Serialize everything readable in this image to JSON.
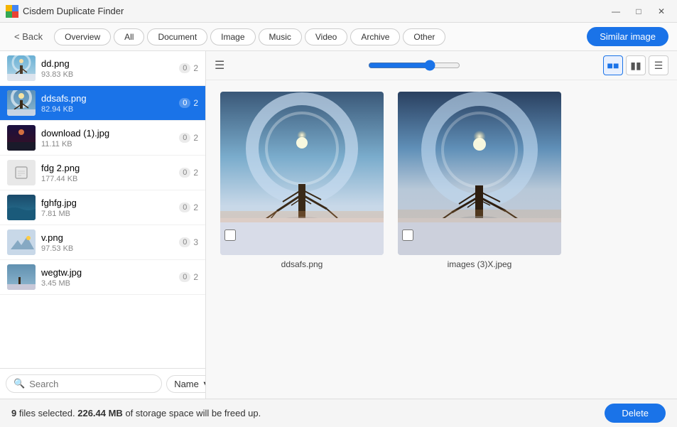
{
  "titleBar": {
    "title": "Cisdem Duplicate Finder",
    "controls": [
      "minimize",
      "maximize",
      "close"
    ]
  },
  "navBar": {
    "backLabel": "< Back",
    "tabs": [
      {
        "label": "Overview",
        "active": false
      },
      {
        "label": "All",
        "active": false
      },
      {
        "label": "Document",
        "active": false
      },
      {
        "label": "Image",
        "active": false
      },
      {
        "label": "Music",
        "active": false
      },
      {
        "label": "Video",
        "active": false
      },
      {
        "label": "Archive",
        "active": false
      },
      {
        "label": "Other",
        "active": false
      }
    ],
    "similarImageBtn": "Similar image"
  },
  "sidebar": {
    "files": [
      {
        "name": "dd.png",
        "size": "93.83 KB",
        "count0": "0",
        "count1": "2",
        "selected": false,
        "hasThumb": true
      },
      {
        "name": "ddsafs.png",
        "size": "82.94 KB",
        "count0": "0",
        "count1": "2",
        "selected": true,
        "hasThumb": true
      },
      {
        "name": "download (1).jpg",
        "size": "11.11 KB",
        "count0": "0",
        "count1": "2",
        "selected": false,
        "hasThumb": true
      },
      {
        "name": "fdg 2.png",
        "size": "177.44 KB",
        "count0": "0",
        "count1": "2",
        "selected": false,
        "hasThumb": false
      },
      {
        "name": "fghfg.jpg",
        "size": "7.81 MB",
        "count0": "0",
        "count1": "2",
        "selected": false,
        "hasThumb": true
      },
      {
        "name": "v.png",
        "size": "97.53 KB",
        "count0": "0",
        "count1": "3",
        "selected": false,
        "hasThumb": true
      },
      {
        "name": "wegtw.jpg",
        "size": "3.45 MB",
        "count0": "0",
        "count1": "2",
        "selected": false,
        "hasThumb": true
      }
    ],
    "searchPlaceholder": "Search",
    "sortLabel": "Name"
  },
  "mainPanel": {
    "sliderValue": 70,
    "images": [
      {
        "filename": "ddsafs.png",
        "label": "ddsafs.png"
      },
      {
        "filename": "images (3)X.jpeg",
        "label": "images (3)X.jpeg"
      }
    ]
  },
  "statusBar": {
    "filesSelected": "9",
    "storageText": "226.44 MB",
    "description": "of storage space will be freed up.",
    "deleteBtn": "Delete"
  }
}
